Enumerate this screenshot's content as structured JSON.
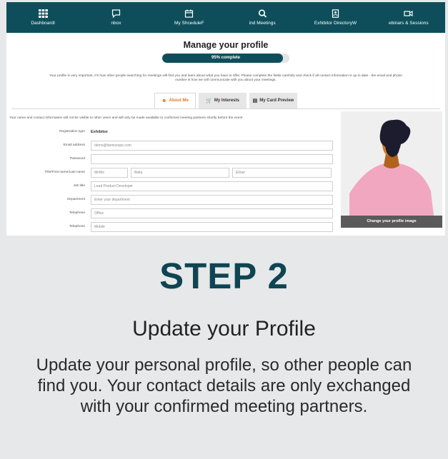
{
  "nav": [
    {
      "label": "DashboardI",
      "icon": "grid-icon"
    },
    {
      "label": "nbox",
      "icon": "message-icon"
    },
    {
      "label": "My ShceduleF",
      "icon": "calendar-icon"
    },
    {
      "label": "ind Meetings",
      "icon": "search-icon"
    },
    {
      "label": "Exhibitor DirectoryW",
      "icon": "directory-icon"
    },
    {
      "label": "ebinars & Sessions",
      "icon": "video-icon"
    }
  ],
  "profile": {
    "title": "Manage your profile",
    "progress_text": "95% complete",
    "progress_value": 0.95,
    "intro": "Your profile is very important, it's how other people searching for meetings will find you and learn about what you have to offer. Please complete the fields carefully and check if all contact information is up to date - the email and phone number is how we will communicate with you about your meetings.",
    "tabs": [
      {
        "label": "About Me",
        "icon": "user-circle-icon",
        "active": true
      },
      {
        "label": "My Interests",
        "icon": "cart-icon",
        "active": false
      },
      {
        "label": "My Card Preview",
        "icon": "card-icon",
        "active": false
      }
    ],
    "notice": "Your name and contact information will not be visible to other users and will only be made available to confirmed meeting partners shortly before the event",
    "form": {
      "registration_type_label": "Registration type",
      "registration_type_value": "Exhibitor",
      "email_label": "Email address",
      "email_value": "demo@demoexpo.com",
      "password_label": "Password",
      "password_value": "",
      "name_label": "Title/First name/Last name",
      "title_placeholder": "Mr/Ms",
      "first_name_value": "Bella",
      "last_name_value": "Elmer",
      "job_title_label": "Job title",
      "job_title_value": "Lead Product Developer",
      "department_label": "Department",
      "department_placeholder": "Enter your department",
      "telephone_label": "Telephone",
      "telephone_placeholder": "Office",
      "telephone2_label": "Telephone",
      "telephone2_placeholder": "Mobile"
    },
    "change_image_label": "Change your profile image",
    "colors": {
      "nav": "#0e4e5a",
      "accent": "#e07b22",
      "avatar_shirt": "#f2a7c0"
    }
  },
  "step": {
    "label": "STEP 2",
    "heading": "Update your Profile",
    "body": "Update your personal profile, so other people can find you. Your contact details are only exchanged with your confirmed meeting partners."
  }
}
